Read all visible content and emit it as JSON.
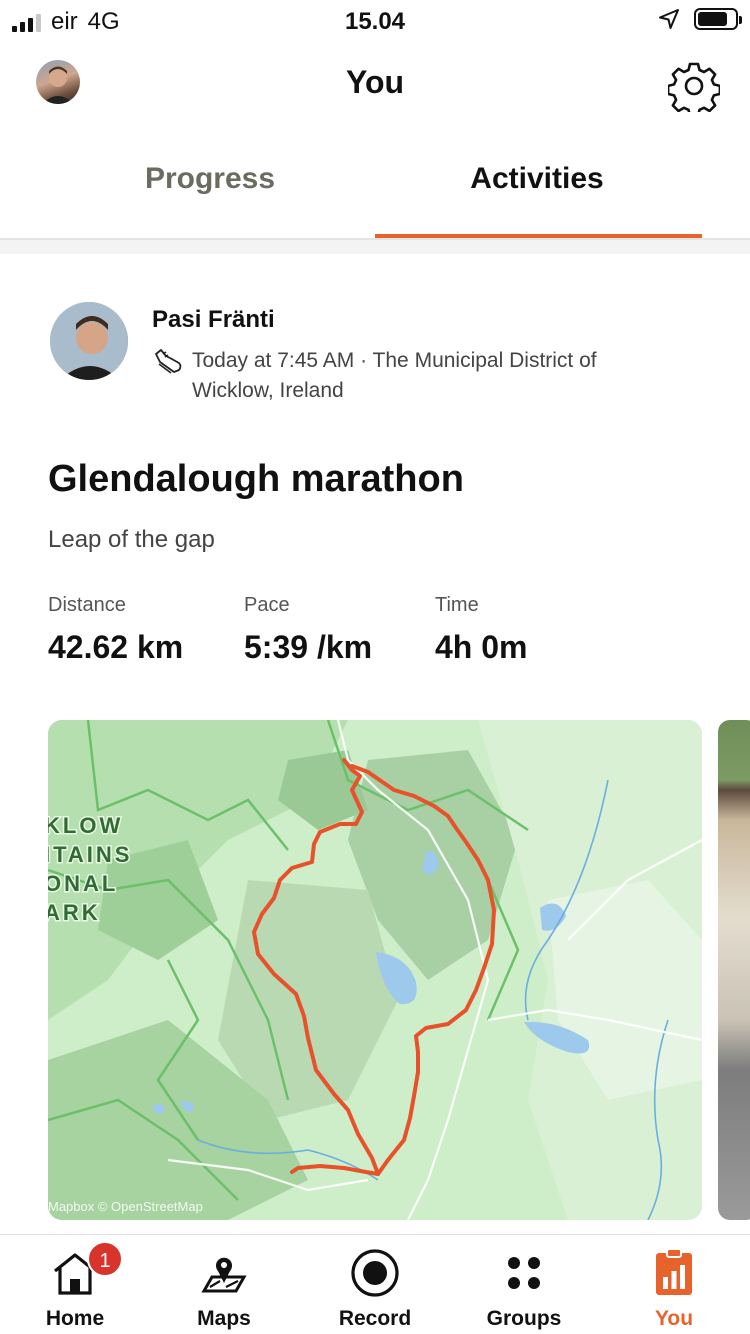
{
  "status_bar": {
    "carrier": "eir",
    "network": "4G",
    "time": "15.04"
  },
  "header": {
    "title": "You",
    "avatar_icon": "avatar",
    "settings_icon": "gear-icon"
  },
  "tabs": [
    {
      "label": "Progress",
      "active": false
    },
    {
      "label": "Activities",
      "active": true
    }
  ],
  "activity": {
    "athlete": "Pasi Fränti",
    "meta": "Today at 7:45 AM · The Municipal District of Wicklow, Ireland",
    "sport_icon": "running-shoe-icon",
    "title": "Glendalough marathon",
    "description": "Leap of the gap",
    "stats": [
      {
        "label": "Distance",
        "value": "42.62 km"
      },
      {
        "label": "Pace",
        "value": "5:39 /km"
      },
      {
        "label": "Time",
        "value": "4h 0m"
      }
    ],
    "map": {
      "park_label_lines": [
        "KLOW",
        "ITAINS",
        "ONAL",
        "ARK"
      ],
      "attribution": "Mapbox © OpenStreetMap",
      "route_color": "#e8522a"
    }
  },
  "tabbar": [
    {
      "label": "Home",
      "icon": "home-icon",
      "badge": "1",
      "active": false
    },
    {
      "label": "Maps",
      "icon": "maps-icon",
      "active": false
    },
    {
      "label": "Record",
      "icon": "record-icon",
      "active": false
    },
    {
      "label": "Groups",
      "icon": "groups-icon",
      "active": false
    },
    {
      "label": "You",
      "icon": "you-icon",
      "active": true
    }
  ],
  "colors": {
    "accent": "#e8622c",
    "badge": "#d9342b"
  }
}
